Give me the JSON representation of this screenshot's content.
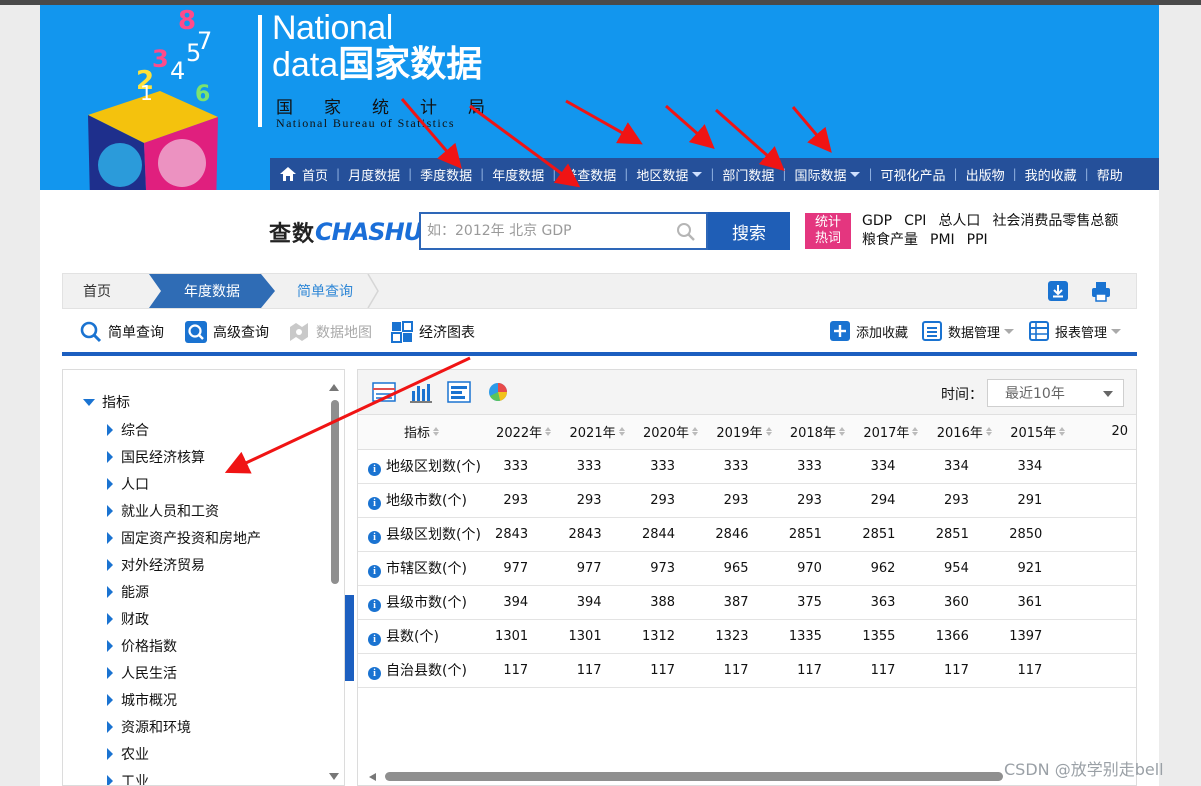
{
  "header": {
    "logo_en_1": "National",
    "logo_en_2": "data",
    "logo_cn": "国家数据",
    "agency_cn": "国家统计局",
    "agency_en": "National Bureau of Statistics",
    "cube_numbers": "1 3 4 5 6 7 8 2"
  },
  "nav": {
    "items": [
      {
        "label": "首页",
        "has_home_icon": true,
        "has_dropdown": false
      },
      {
        "label": "月度数据",
        "has_dropdown": false
      },
      {
        "label": "季度数据",
        "has_dropdown": false
      },
      {
        "label": "年度数据",
        "has_dropdown": false
      },
      {
        "label": "普查数据",
        "has_dropdown": false
      },
      {
        "label": "地区数据",
        "has_dropdown": true
      },
      {
        "label": "部门数据",
        "has_dropdown": false
      },
      {
        "label": "国际数据",
        "has_dropdown": true
      },
      {
        "label": "可视化产品",
        "has_dropdown": false
      },
      {
        "label": "出版物",
        "has_dropdown": false
      },
      {
        "label": "我的收藏",
        "has_dropdown": false
      },
      {
        "label": "帮助",
        "has_dropdown": false
      }
    ]
  },
  "search": {
    "brand_cn": "查数",
    "brand_en": "CHASHU",
    "placeholder": "如：2012年 北京 GDP",
    "button_label": "搜索",
    "hot_badge": "统计热词",
    "hot_words": [
      "GDP",
      "CPI",
      "总人口",
      "社会消费品零售总额",
      "粮食产量",
      "PMI",
      "PPI"
    ]
  },
  "breadcrumb": {
    "home": "首页",
    "year": "年度数据",
    "current": "简单查询"
  },
  "toolbar": {
    "simple_query": "简单查询",
    "advanced_query": "高级查询",
    "data_map": "数据地图",
    "economic_chart": "经济图表",
    "add_favorite": "添加收藏",
    "data_manage": "数据管理",
    "report_manage": "报表管理"
  },
  "tree": {
    "root": "指标",
    "items": [
      "综合",
      "国民经济核算",
      "人口",
      "就业人员和工资",
      "固定资产投资和房地产",
      "对外经济贸易",
      "能源",
      "财政",
      "价格指数",
      "人民生活",
      "城市概况",
      "资源和环境",
      "农业",
      "工业"
    ]
  },
  "data_view": {
    "time_label": "时间：",
    "time_value": "最近10年",
    "header_indicator": "指标",
    "years": [
      "2022年",
      "2021年",
      "2020年",
      "2019年",
      "2018年",
      "2017年",
      "2016年",
      "2015年",
      "20"
    ],
    "rows": [
      {
        "name": "地级区划数(个)",
        "values": [
          "333",
          "333",
          "333",
          "333",
          "333",
          "334",
          "334",
          "334"
        ]
      },
      {
        "name": "地级市数(个)",
        "values": [
          "293",
          "293",
          "293",
          "293",
          "293",
          "294",
          "293",
          "291"
        ]
      },
      {
        "name": "县级区划数(个)",
        "values": [
          "2843",
          "2843",
          "2844",
          "2846",
          "2851",
          "2851",
          "2851",
          "2850"
        ]
      },
      {
        "name": "市辖区数(个)",
        "values": [
          "977",
          "977",
          "973",
          "965",
          "970",
          "962",
          "954",
          "921"
        ]
      },
      {
        "name": "县级市数(个)",
        "values": [
          "394",
          "394",
          "388",
          "387",
          "375",
          "363",
          "360",
          "361"
        ]
      },
      {
        "name": "县数(个)",
        "values": [
          "1301",
          "1301",
          "1312",
          "1323",
          "1335",
          "1355",
          "1366",
          "1397"
        ]
      },
      {
        "name": "自治县数(个)",
        "values": [
          "117",
          "117",
          "117",
          "117",
          "117",
          "117",
          "117",
          "117"
        ]
      }
    ]
  },
  "watermark": "CSDN @放学别走bell",
  "colors": {
    "banner": "#1296ee",
    "nav": "#25509a",
    "accent": "#1c5fc0",
    "hot": "#e4367f",
    "annotation_arrow": "#f01414"
  }
}
